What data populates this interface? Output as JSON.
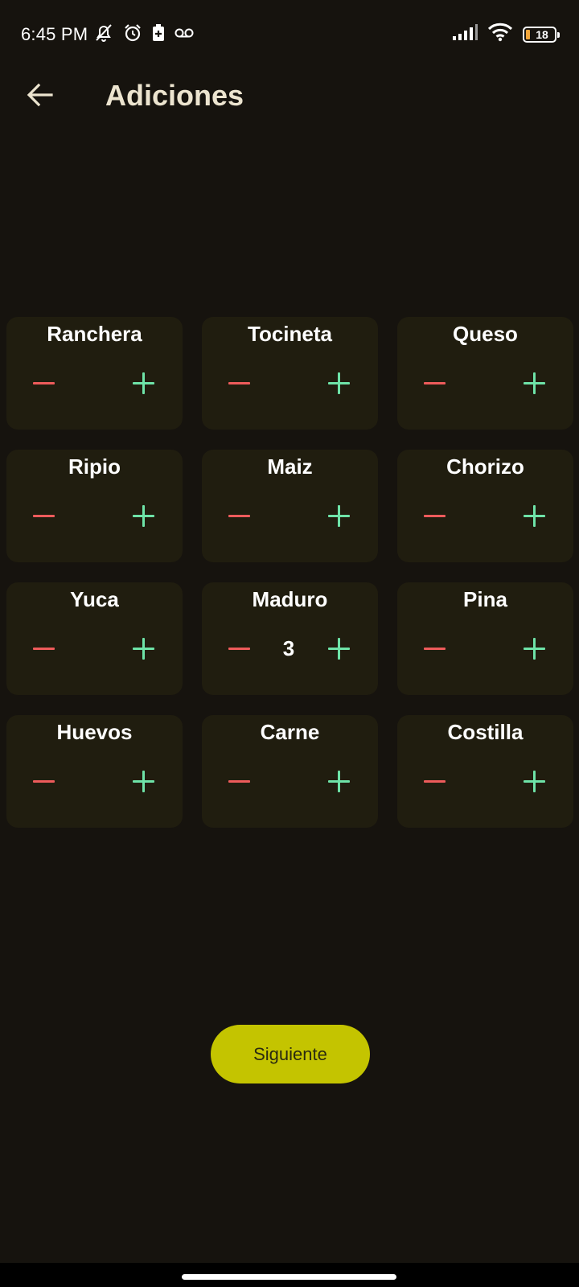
{
  "status_bar": {
    "time": "6:45 PM",
    "icons_left": [
      "bell-off-icon",
      "alarm-clock-icon",
      "battery-saver-icon",
      "voicemail-icon"
    ],
    "icons_right": [
      "signal-icon",
      "wifi-icon",
      "battery-icon"
    ],
    "battery_level": "18"
  },
  "header": {
    "back_icon": "arrow-left-icon",
    "title": "Adiciones"
  },
  "colors": {
    "background": "#16130e",
    "card": "#201d0f",
    "minus": "#ee5b5b",
    "plus": "#6ee3a8",
    "accent": "#c4c400",
    "title": "#ece4cf"
  },
  "items": [
    {
      "name": "Ranchera",
      "quantity": ""
    },
    {
      "name": "Tocineta",
      "quantity": ""
    },
    {
      "name": "Queso",
      "quantity": ""
    },
    {
      "name": "Ripio",
      "quantity": ""
    },
    {
      "name": "Maiz",
      "quantity": ""
    },
    {
      "name": "Chorizo",
      "quantity": ""
    },
    {
      "name": "Yuca",
      "quantity": ""
    },
    {
      "name": "Maduro",
      "quantity": "3"
    },
    {
      "name": "Pina",
      "quantity": ""
    },
    {
      "name": "Huevos",
      "quantity": ""
    },
    {
      "name": "Carne",
      "quantity": ""
    },
    {
      "name": "Costilla",
      "quantity": ""
    }
  ],
  "footer": {
    "next_label": "Siguiente"
  }
}
